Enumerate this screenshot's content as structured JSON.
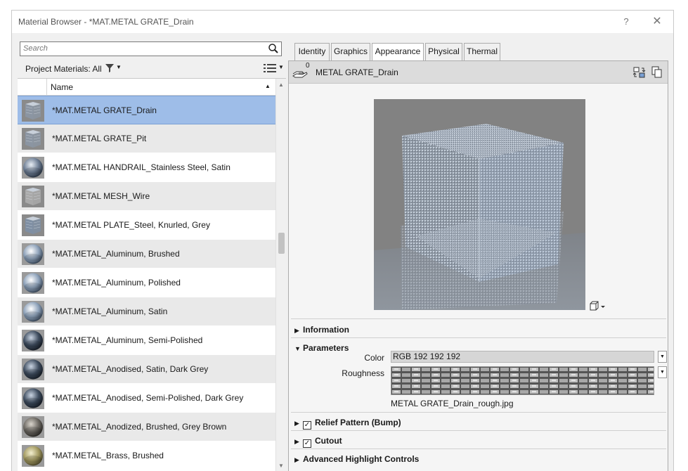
{
  "window": {
    "title": "Material Browser - *MAT.METAL GRATE_Drain",
    "help_label": "?",
    "close_label": "✕"
  },
  "browser": {
    "search_placeholder": "Search",
    "filter_label": "Project Materials: All",
    "column_name": "Name",
    "materials": [
      {
        "name": "*MAT.METAL GRATE_Drain",
        "thumb": "cube-grate",
        "selected": true
      },
      {
        "name": "*MAT.METAL GRATE_Pit",
        "thumb": "cube-grate"
      },
      {
        "name": "*MAT.METAL HANDRAIL_Stainless Steel, Satin",
        "thumb": "sphere-steel"
      },
      {
        "name": "*MAT.METAL MESH_Wire",
        "thumb": "cube-mesh"
      },
      {
        "name": "*MAT.METAL PLATE_Steel, Knurled, Grey",
        "thumb": "cube-plate"
      },
      {
        "name": "*MAT.METAL_Aluminum, Brushed",
        "thumb": "sphere-chrome"
      },
      {
        "name": "*MAT.METAL_Aluminum, Polished",
        "thumb": "sphere-chrome"
      },
      {
        "name": "*MAT.METAL_Aluminum, Satin",
        "thumb": "sphere-chrome"
      },
      {
        "name": "*MAT.METAL_Aluminum, Semi-Polished",
        "thumb": "sphere-dark"
      },
      {
        "name": "*MAT.METAL_Anodised, Satin, Dark Grey",
        "thumb": "sphere-dark"
      },
      {
        "name": "*MAT.METAL_Anodised, Semi-Polished, Dark Grey",
        "thumb": "sphere-dark"
      },
      {
        "name": "*MAT.METAL_Anodized, Brushed, Grey Brown",
        "thumb": "sphere-brown"
      },
      {
        "name": "*MAT.METAL_Brass, Brushed",
        "thumb": "sphere-brass"
      }
    ]
  },
  "editor": {
    "tabs": [
      "Identity",
      "Graphics",
      "Appearance",
      "Physical",
      "Thermal"
    ],
    "active_tab": "Appearance",
    "asset_count": "0",
    "asset_name": "METAL GRATE_Drain",
    "sections": {
      "information": "Information",
      "parameters": "Parameters",
      "relief": "Relief Pattern (Bump)",
      "cutout": "Cutout",
      "advanced": "Advanced Highlight Controls"
    },
    "color_label": "Color",
    "color_value": "RGB 192 192 192",
    "roughness_label": "Roughness",
    "roughness_file": "METAL GRATE_Drain_rough.jpg",
    "relief_checked": true,
    "cutout_checked": true
  }
}
